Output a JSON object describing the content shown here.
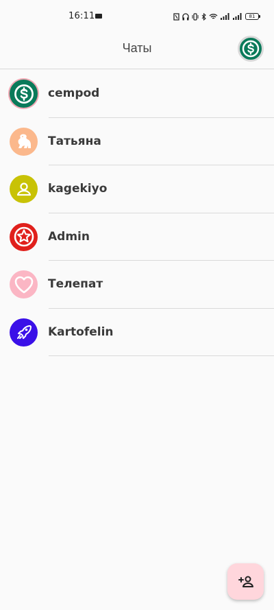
{
  "status_bar": {
    "time": "16:11",
    "battery": "81"
  },
  "header": {
    "title": "Чаты"
  },
  "chats": [
    {
      "name": "cempod",
      "avatar_icon": "dollar-icon",
      "avatar_color": "#0a7a5a",
      "ring_color": "#f0a8b4"
    },
    {
      "name": "Татьяна",
      "avatar_icon": "gorilla-icon",
      "avatar_color": "#fbb88c"
    },
    {
      "name": "kagekiyo",
      "avatar_icon": "user-icon",
      "avatar_color": "#c8c206"
    },
    {
      "name": "Admin",
      "avatar_icon": "star-icon",
      "avatar_color": "#e0201c"
    },
    {
      "name": "Телепат",
      "avatar_icon": "heart-icon",
      "avatar_color": "#fbb6c4"
    },
    {
      "name": "Kartofelin",
      "avatar_icon": "rocket-icon",
      "avatar_color": "#3a10e8"
    }
  ],
  "fab": {
    "icon": "add-user-icon",
    "color": "#ffd6dc"
  }
}
